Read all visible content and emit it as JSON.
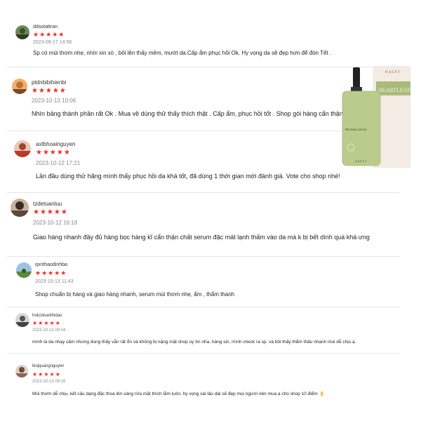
{
  "reviews": [
    {
      "username": "ddsotattran",
      "rating": 5,
      "stars": "★★★★★",
      "timestamp": "2023-09-17 14:56",
      "comment": "Sp có mùi thơm nhẹ, nhìn xin xò , bôi lên thấy mềm, mướt da.Cấp ẩm phục hồi Ok. Hy vọng da sẽ đẹp hơn để đón Tết ."
    },
    {
      "username": "ptdnbibihienbi",
      "rating": 5,
      "stars": "★★★★★",
      "timestamp": "2023-10-13 10:06",
      "comment": "Nhìn bảng thành phần rất Ok . Mua về dùng thử thấy thích thật . Cấp ẩm, phục hồi tốt . Shop gói hàng cẩn thận ."
    },
    {
      "username": "axtbhoainguyen",
      "rating": 5,
      "stars": "★★★★★",
      "timestamp": "2023-10-12 17:21",
      "comment": "Lần đầu dùng thử hãng mình thấy phục hồi da khá tốt, đã dùng 1 thời gian mới đánh giá. Vote cho shop nhé!"
    },
    {
      "username": "tzdetuanluu",
      "rating": 5,
      "stars": "★★★★★",
      "timestamp": "2023-10-12 16:18",
      "comment": "Giao hàng nhanh đầy đủ hàng bọc hàng kĩ cẩn thận chất serum đặc mát lạnh thấm vào da mà k bị bết dính quá khá ưng"
    },
    {
      "username": "qxrithaodinhba",
      "rating": 5,
      "stars": "★★★★★",
      "timestamp": "2023-10-13 11:43",
      "comment": "Shop chuẩn bị hàng và giao hàng nhanh, serum mùi thơm nhẹ, ẩm , thẩm thanh"
    },
    {
      "username": "hokzdoanthidao",
      "rating": 5,
      "stars": "★★★★★",
      "timestamp": "2023-10-13 09:04",
      "comment": "mình là da nhạy cảm nhưng dùng thấy vẫn rất ổn và không bị nặng mặt shop uy tín nha, hàng sịn, mình check ra sp. và bôi thấy thẩm thấu nhanh mùi dễ chịu ạ."
    },
    {
      "username": "lkojquangnguyen",
      "rating": 5,
      "stars": "★★★★★",
      "timestamp": "2023-10-13 09:16",
      "comment": "Mùi thơm dễ chịu, kết cấu dạng đặc thoa lên sáng rửa mặt thích lắm luôn, hy vọng xài lâu dài sẽ đẹp mọi người nên mua ạ cho shop 10 điểm 👌"
    }
  ],
  "product": {
    "brand": "NAEXY",
    "line": "HEARTLEAF",
    "name": "Recovery serum",
    "bottle_brand": "NAEXY",
    "colors": {
      "bottle": "#b9cc8c",
      "box": "#f4ece4",
      "box_band": "#a9bb7c",
      "pump": "#222222",
      "star": "#ee2d24"
    }
  }
}
